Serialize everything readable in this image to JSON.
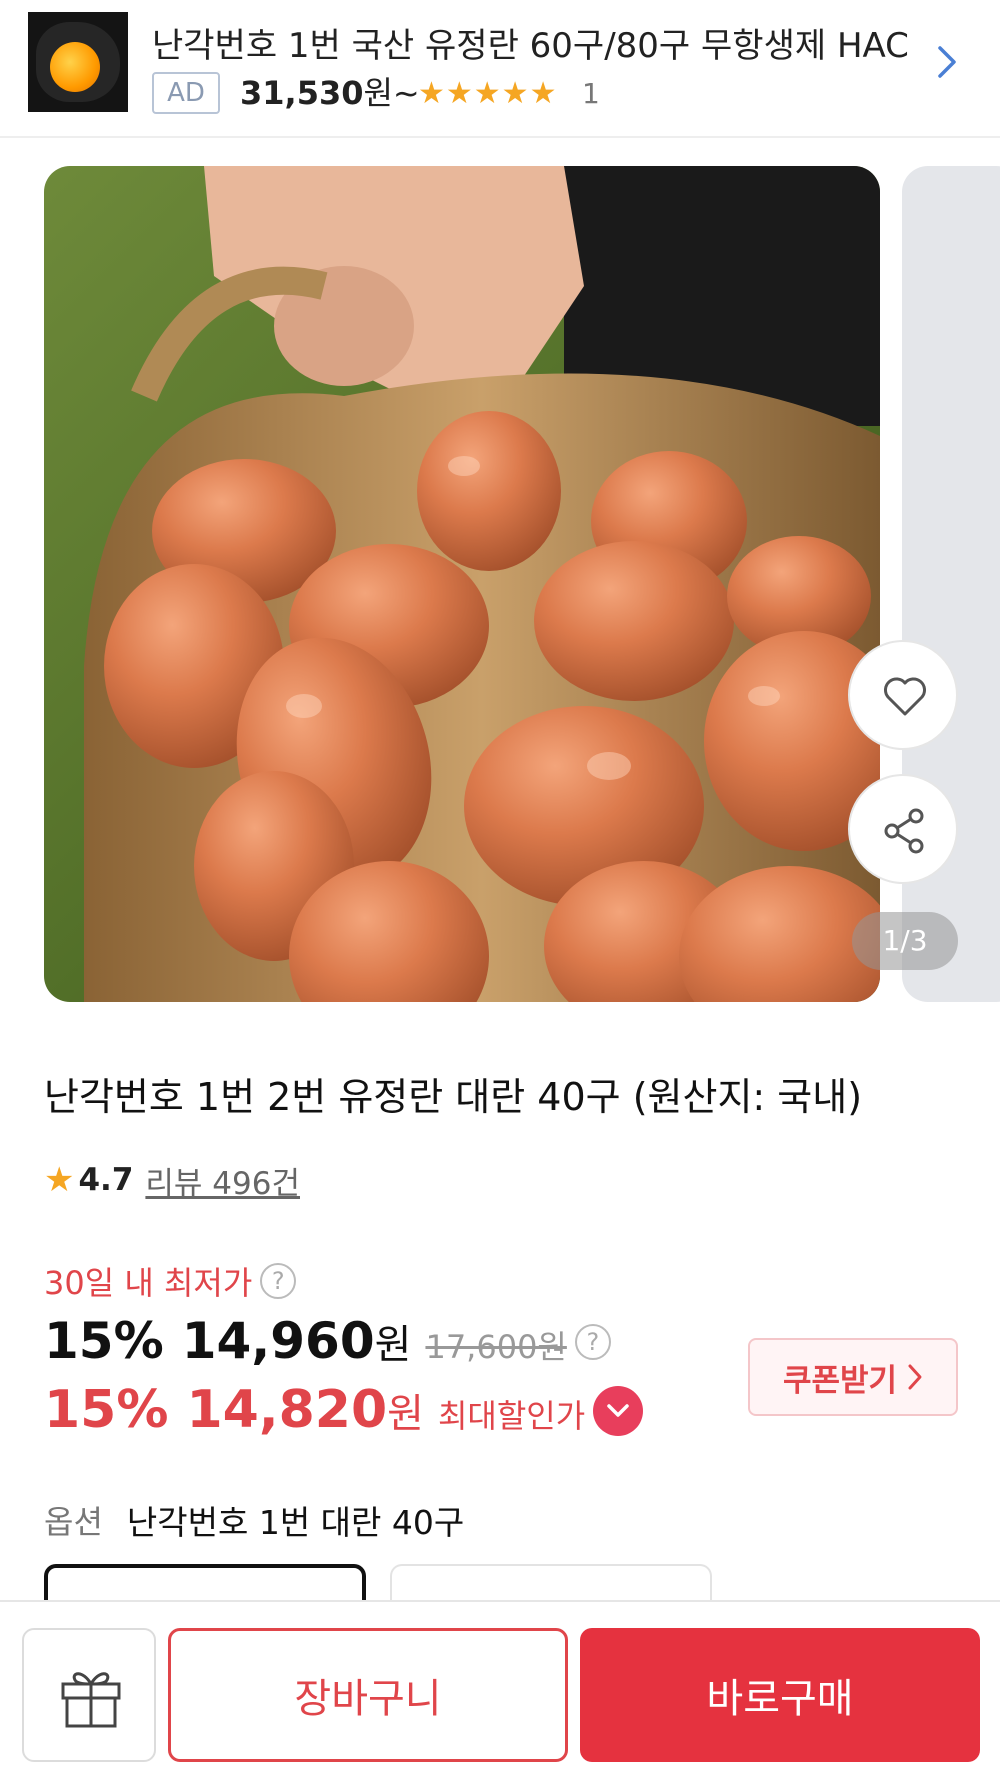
{
  "ad": {
    "title": "난각번호 1번 국산 유정란 60구/80구 무항생제 HAC",
    "badge": "AD",
    "price": "31,530",
    "price_suffix": "원~",
    "stars": "★★★★★",
    "rating_count": "1"
  },
  "gallery": {
    "page_indicator": "1/3",
    "current_page": 1,
    "total_pages": 3
  },
  "product": {
    "title": "난각번호 1번 2번 유정란 대란 40구 (원산지: 국내)",
    "rating_star": "★",
    "rating": "4.7",
    "review_text": "리뷰 496건"
  },
  "pricing": {
    "lowest_label": "30일 내 최저가",
    "help_symbol": "?",
    "discount1": "15%",
    "price1": "14,960",
    "won": "원",
    "original_price": "17,600원",
    "discount2": "15%",
    "price2": "14,820",
    "max_discount_label": "최대할인가",
    "coupon_label": "쿠폰받기"
  },
  "option": {
    "label": "옵션",
    "value": "난각번호 1번 대란 40구"
  },
  "bottom_bar": {
    "cart_label": "장바구니",
    "buy_label": "바로구매"
  },
  "colors": {
    "accent_red": "#e0454a",
    "buy_button": "#e5323f",
    "star": "#f5a623"
  }
}
